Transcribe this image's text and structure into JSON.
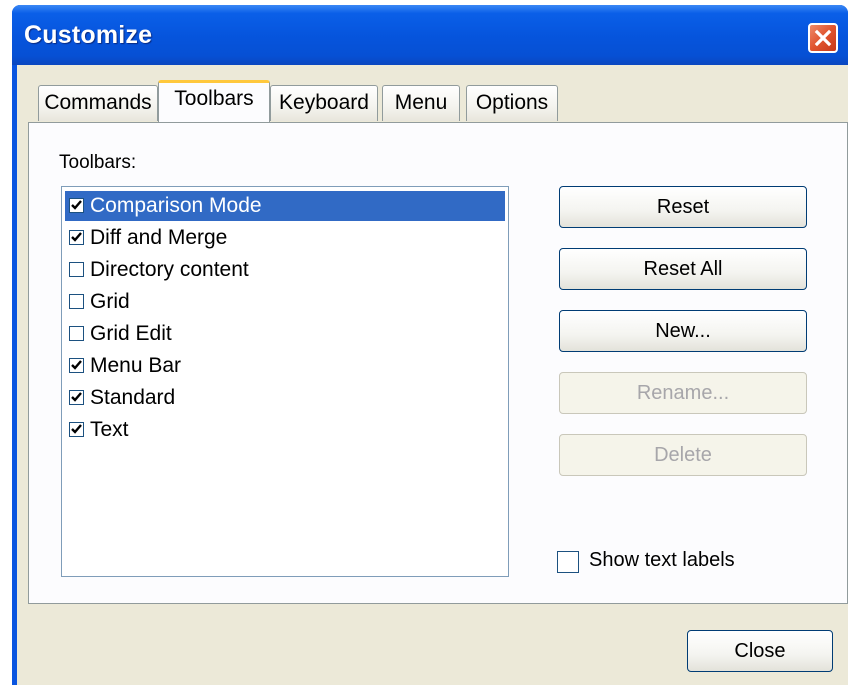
{
  "window": {
    "title": "Customize"
  },
  "tabs": [
    {
      "label": "Commands",
      "active": false
    },
    {
      "label": "Toolbars",
      "active": true
    },
    {
      "label": "Keyboard",
      "active": false
    },
    {
      "label": "Menu",
      "active": false
    },
    {
      "label": "Options",
      "active": false
    }
  ],
  "toolbars_panel": {
    "list_label": "Toolbars:",
    "items": [
      {
        "label": "Comparison Mode",
        "checked": true,
        "selected": true
      },
      {
        "label": "Diff and Merge",
        "checked": true,
        "selected": false
      },
      {
        "label": "Directory content",
        "checked": false,
        "selected": false
      },
      {
        "label": "Grid",
        "checked": false,
        "selected": false
      },
      {
        "label": "Grid Edit",
        "checked": false,
        "selected": false
      },
      {
        "label": "Menu Bar",
        "checked": true,
        "selected": false
      },
      {
        "label": "Standard",
        "checked": true,
        "selected": false
      },
      {
        "label": "Text",
        "checked": true,
        "selected": false
      }
    ],
    "buttons": {
      "reset": "Reset",
      "reset_all": "Reset All",
      "new": "New...",
      "rename": "Rename...",
      "delete": "Delete"
    },
    "show_text_labels": {
      "label": "Show text labels",
      "checked": false
    }
  },
  "footer": {
    "close_label": "Close"
  },
  "colors": {
    "titlebar": "#0654dc",
    "selection": "#316ac5",
    "active_tab_accent": "#ffc83c",
    "dialog_background": "#ece9d8",
    "close_button": "#e0542e"
  }
}
